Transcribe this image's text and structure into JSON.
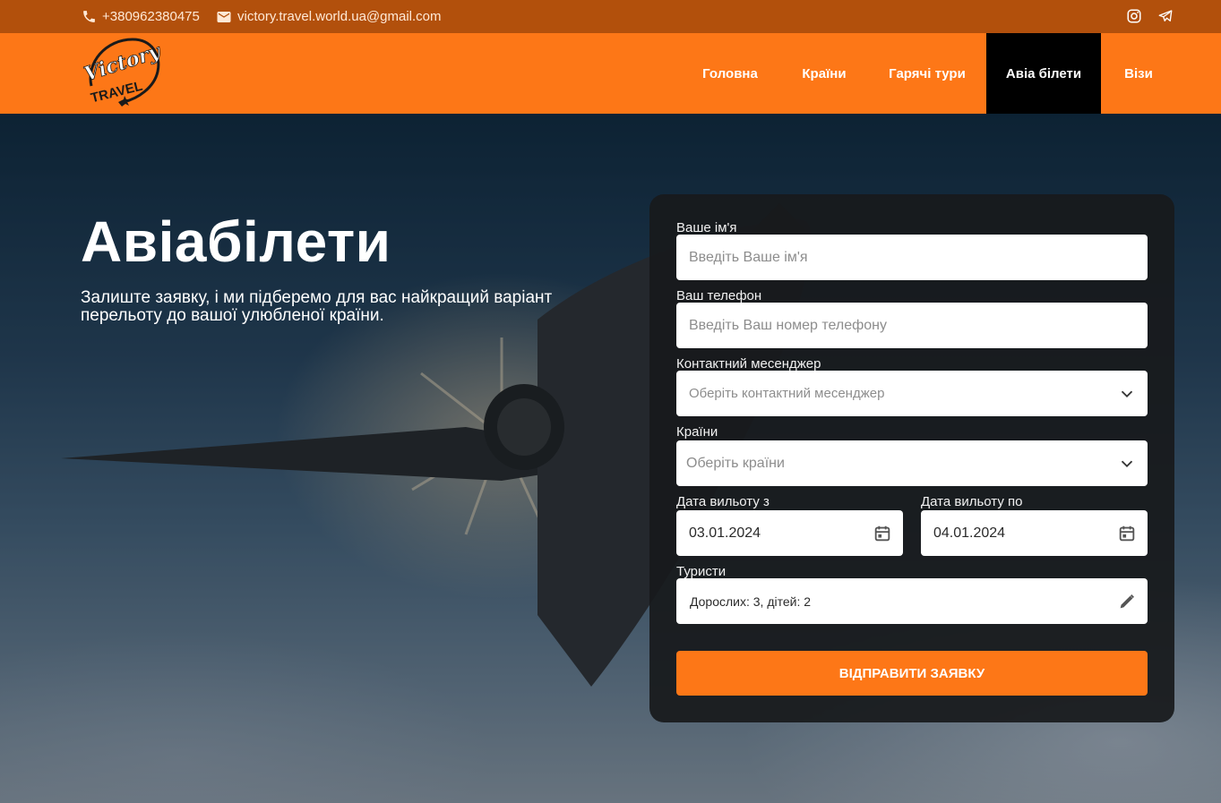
{
  "colors": {
    "topbar": "#b2500c",
    "navbar": "#fd7717",
    "active_nav": "#000000",
    "form_bg": "#181a1c",
    "button": "#fd7717"
  },
  "topbar": {
    "phone": "+380962380475",
    "email": "victory.travel.world.ua@gmail.com",
    "icons": [
      "phone-icon",
      "mail-icon",
      "instagram-icon",
      "telegram-icon"
    ]
  },
  "nav": {
    "logo_text_1": "Victory",
    "logo_text_2": "TRAVEL",
    "items": [
      {
        "label": "Головна"
      },
      {
        "label": "Країни"
      },
      {
        "label": "Гарячі тури"
      },
      {
        "label": "Авіа білети",
        "active": true
      },
      {
        "label": "Візи"
      }
    ]
  },
  "hero": {
    "title": "Авіабілети",
    "subtitle": "Залиште заявку, і ми підберемо для вас найкращий варіант перельоту до вашої улюбленої країни."
  },
  "form": {
    "name": {
      "label": "Ваше ім'я",
      "placeholder": "Введіть Ваше ім'я"
    },
    "phone": {
      "label": "Ваш телефон",
      "placeholder": "Введіть Ваш номер телефону"
    },
    "messenger": {
      "label": "Контактний месенджер",
      "placeholder": "Оберіть контактний месенджер"
    },
    "countries": {
      "label": "Країни",
      "placeholder": "Оберіть країни"
    },
    "date_from": {
      "label": "Дата вильоту з",
      "value": "03.01.2024"
    },
    "date_to": {
      "label": "Дата вильоту по",
      "value": "04.01.2024"
    },
    "tourists": {
      "label": "Туристи",
      "value": "Дорослих: 3, дітей: 2"
    },
    "submit": "ВІДПРАВИТИ ЗАЯВКУ"
  }
}
